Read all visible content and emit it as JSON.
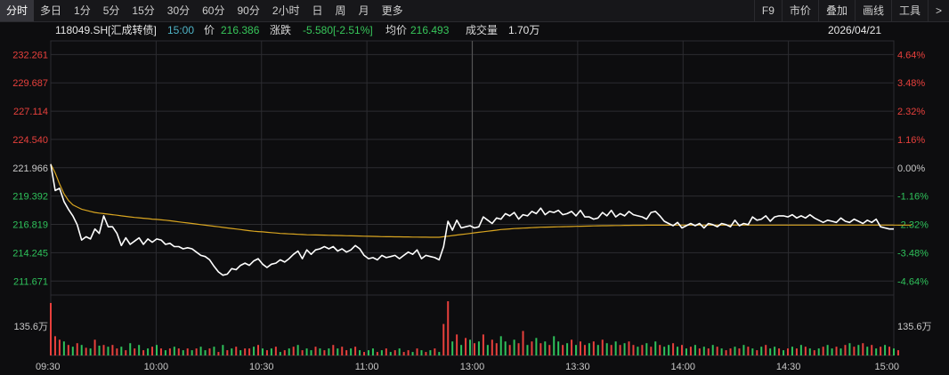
{
  "toolbar": {
    "tabs": [
      "分时",
      "多日",
      "1分",
      "5分",
      "15分",
      "30分",
      "60分",
      "90分",
      "2小时",
      "日",
      "周",
      "月",
      "更多"
    ],
    "right_buttons": [
      "F9",
      "市价",
      "叠加",
      "画线",
      "工具",
      ">"
    ]
  },
  "info": {
    "code": "118049.SH[汇成转债]",
    "time": "15:00",
    "price_label": "价",
    "price": "216.386",
    "change_label": "涨跌",
    "change": "-5.580[-2.51%]",
    "avg_label": "均价",
    "avg": "216.493",
    "volume_label": "成交量",
    "volume": "1.70万",
    "date": "2026/04/21"
  },
  "colors": {
    "up": "#e8403c",
    "down": "#2fc25b",
    "price_line": "#ffffff",
    "avg_line": "#d9a520",
    "grid": "#2c2c30",
    "neutral_text": "#c8c8c8"
  },
  "chart_data": {
    "type": "line",
    "prev_close": 221.966,
    "ylim": [
      210.4,
      233.5
    ],
    "y_ticks_left": [
      "232.261",
      "229.687",
      "227.114",
      "224.540",
      "221.966",
      "219.392",
      "216.819",
      "214.245",
      "211.671"
    ],
    "y_ticks_right": [
      "4.64%",
      "3.48%",
      "2.32%",
      "1.16%",
      "0.00%",
      "-1.16%",
      "-2.32%",
      "-3.48%",
      "-4.64%"
    ],
    "x_ticks": [
      "09:30",
      "10:00",
      "10:30",
      "11:00",
      "13:00",
      "13:30",
      "14:00",
      "14:30",
      "15:00"
    ],
    "volume_tick": "135.6万",
    "series": [
      {
        "values": [
          222.3,
          219.9,
          220.1,
          218.9,
          218.2,
          217.6,
          216.8,
          215.4,
          215.7,
          215.5,
          216.4,
          216.0,
          217.6,
          216.6,
          216.6,
          216.0,
          214.9,
          215.6,
          215.0,
          215.3,
          215.6,
          215.0,
          215.5,
          215.2,
          215.5,
          215.4,
          215.0,
          215.1,
          214.8,
          214.8,
          214.6,
          214.7,
          214.6,
          214.3,
          214.0,
          213.9,
          213.6,
          213.0,
          212.5,
          212.2,
          212.3,
          212.8,
          212.7,
          213.1,
          213.3,
          213.1,
          213.5,
          213.7,
          213.2,
          212.9,
          213.2,
          213.3,
          213.6,
          213.4,
          213.7,
          214.1,
          214.4,
          213.7,
          214.5,
          214.1,
          214.5,
          214.6,
          214.8,
          214.6,
          214.8,
          214.4,
          214.6,
          214.3,
          214.5,
          214.9,
          214.6,
          214.0,
          213.7,
          213.8,
          213.6,
          214.0,
          213.8,
          213.9,
          214.0,
          213.7,
          214.0,
          214.3,
          214.1,
          214.5,
          213.7,
          214.0,
          213.9,
          213.8,
          213.6,
          214.8,
          217.1,
          216.3,
          217.2,
          216.5,
          216.6,
          216.7,
          216.5,
          216.6,
          217.5,
          217.2,
          216.9,
          217.4,
          217.3,
          217.8,
          217.6,
          217.9,
          217.3,
          217.7,
          217.6,
          218.0,
          217.8,
          218.3,
          217.7,
          218.0,
          217.9,
          218.1,
          217.7,
          217.8,
          218.0,
          217.6,
          218.1,
          217.5,
          217.5,
          217.3,
          217.4,
          217.9,
          217.6,
          218.1,
          217.5,
          217.8,
          217.6,
          218.0,
          217.7,
          217.6,
          217.5,
          217.3,
          217.9,
          218.0,
          217.6,
          217.1,
          216.9,
          216.7,
          217.0,
          216.5,
          216.7,
          216.9,
          216.7,
          216.9,
          216.5,
          216.9,
          216.8,
          216.6,
          216.9,
          216.8,
          216.6,
          217.2,
          216.7,
          216.9,
          216.8,
          217.5,
          217.2,
          217.3,
          217.6,
          217.1,
          217.5,
          217.6,
          217.6,
          217.5,
          217.7,
          217.4,
          217.6,
          217.4,
          217.7,
          217.4,
          217.2,
          217.0,
          217.2,
          217.1,
          217.0,
          217.4,
          217.1,
          217.0,
          217.3,
          217.1,
          216.9,
          217.2,
          217.0,
          217.3,
          216.6,
          216.5,
          216.4,
          216.4
        ]
      },
      {
        "values": [
          222.3,
          221.5,
          220.5,
          219.6,
          219.0,
          218.6,
          218.4,
          218.2,
          218.1,
          218.0,
          217.9,
          217.85,
          217.8,
          217.75,
          217.7,
          217.65,
          217.6,
          217.55,
          217.5,
          217.45,
          217.42,
          217.38,
          217.35,
          217.3,
          217.27,
          217.23,
          217.2,
          217.15,
          217.1,
          217.05,
          217.0,
          216.95,
          216.9,
          216.85,
          216.8,
          216.75,
          216.7,
          216.65,
          216.6,
          216.55,
          216.5,
          216.45,
          216.4,
          216.35,
          216.3,
          216.25,
          216.2,
          216.17,
          216.14,
          216.1,
          216.07,
          216.04,
          216.0,
          215.98,
          215.96,
          215.94,
          215.92,
          215.9,
          215.88,
          215.87,
          215.86,
          215.85,
          215.84,
          215.83,
          215.82,
          215.81,
          215.8,
          215.79,
          215.78,
          215.77,
          215.76,
          215.75,
          215.74,
          215.73,
          215.72,
          215.71,
          215.7,
          215.7,
          215.69,
          215.69,
          215.68,
          215.68,
          215.67,
          215.67,
          215.66,
          215.66,
          215.65,
          215.65,
          215.65,
          215.7,
          215.75,
          215.8,
          215.85,
          215.9,
          215.95,
          216.0,
          216.05,
          216.1,
          216.15,
          216.2,
          216.25,
          216.3,
          216.35,
          216.38,
          216.41,
          216.44,
          216.46,
          216.48,
          216.5,
          216.52,
          216.54,
          216.56,
          216.57,
          216.58,
          216.59,
          216.6,
          216.61,
          216.62,
          216.63,
          216.64,
          216.65,
          216.66,
          216.67,
          216.68,
          216.69,
          216.7,
          216.7,
          216.71,
          216.72,
          216.72,
          216.73,
          216.73,
          216.74,
          216.74,
          216.74,
          216.75,
          216.75,
          216.75,
          216.75,
          216.75,
          216.75,
          216.76,
          216.76,
          216.76,
          216.76,
          216.76,
          216.76,
          216.76,
          216.76,
          216.76,
          216.76,
          216.76,
          216.76,
          216.76,
          216.76,
          216.76,
          216.76,
          216.76,
          216.76,
          216.76,
          216.76,
          216.76,
          216.76,
          216.76,
          216.76,
          216.76,
          216.76,
          216.76,
          216.76,
          216.76,
          216.76,
          216.76,
          216.76,
          216.76,
          216.76,
          216.76,
          216.76,
          216.76,
          216.76,
          216.76,
          216.76,
          216.76,
          216.76,
          216.76,
          216.76,
          216.76,
          216.76,
          216.76,
          216.76,
          216.76,
          216.76,
          216.76,
          216.76,
          216.76,
          216.76,
          216.76
        ]
      }
    ],
    "volume_ratio": [
      1.5,
      0.55,
      0.45,
      0.4,
      0.3,
      0.25,
      0.35,
      0.3,
      0.22,
      0.2,
      0.45,
      0.28,
      0.3,
      0.25,
      0.3,
      0.2,
      0.25,
      0.15,
      0.35,
      0.2,
      0.3,
      0.15,
      0.2,
      0.25,
      0.3,
      0.2,
      0.15,
      0.2,
      0.25,
      0.2,
      0.15,
      0.2,
      0.15,
      0.2,
      0.25,
      0.15,
      0.2,
      0.25,
      0.1,
      0.3,
      0.15,
      0.2,
      0.25,
      0.15,
      0.2,
      0.2,
      0.25,
      0.3,
      0.2,
      0.15,
      0.2,
      0.25,
      0.1,
      0.15,
      0.2,
      0.25,
      0.3,
      0.15,
      0.2,
      0.15,
      0.25,
      0.2,
      0.15,
      0.2,
      0.3,
      0.2,
      0.25,
      0.15,
      0.2,
      0.25,
      0.15,
      0.1,
      0.15,
      0.2,
      0.1,
      0.15,
      0.2,
      0.1,
      0.15,
      0.2,
      0.1,
      0.15,
      0.1,
      0.2,
      0.15,
      0.1,
      0.15,
      0.2,
      0.1,
      0.9,
      1.55,
      0.4,
      0.6,
      0.3,
      0.5,
      0.45,
      0.35,
      0.4,
      0.6,
      0.3,
      0.45,
      0.35,
      0.55,
      0.4,
      0.3,
      0.45,
      0.35,
      0.7,
      0.3,
      0.4,
      0.5,
      0.35,
      0.4,
      0.3,
      0.55,
      0.4,
      0.3,
      0.35,
      0.45,
      0.3,
      0.4,
      0.3,
      0.35,
      0.4,
      0.3,
      0.45,
      0.35,
      0.3,
      0.4,
      0.3,
      0.35,
      0.4,
      0.3,
      0.25,
      0.3,
      0.35,
      0.25,
      0.4,
      0.3,
      0.25,
      0.3,
      0.35,
      0.25,
      0.3,
      0.2,
      0.25,
      0.3,
      0.2,
      0.25,
      0.2,
      0.3,
      0.25,
      0.2,
      0.15,
      0.2,
      0.25,
      0.2,
      0.3,
      0.25,
      0.2,
      0.15,
      0.25,
      0.3,
      0.2,
      0.25,
      0.2,
      0.15,
      0.2,
      0.25,
      0.2,
      0.3,
      0.25,
      0.2,
      0.15,
      0.2,
      0.25,
      0.3,
      0.2,
      0.25,
      0.2,
      0.3,
      0.35,
      0.25,
      0.3,
      0.35,
      0.25,
      0.3,
      0.2,
      0.25,
      0.3,
      0.25,
      0.2,
      0.15
    ],
    "volume_dir": [
      1,
      1,
      1,
      0,
      1,
      0,
      1,
      0,
      1,
      0,
      1,
      0,
      1,
      0,
      1,
      1,
      0,
      1,
      0,
      1,
      0,
      1,
      0,
      1,
      0,
      1,
      0,
      1,
      0,
      1,
      0,
      1,
      0,
      1,
      0,
      0,
      1,
      0,
      1,
      0,
      1,
      0,
      1,
      0,
      1,
      1,
      0,
      1,
      0,
      1,
      0,
      1,
      0,
      1,
      0,
      1,
      0,
      1,
      0,
      0,
      1,
      0,
      1,
      0,
      1,
      0,
      1,
      1,
      0,
      1,
      0,
      1,
      0,
      0,
      1,
      0,
      1,
      0,
      1,
      0,
      1,
      1,
      0,
      1,
      0,
      1,
      0,
      1,
      0,
      1,
      1,
      0,
      1,
      0,
      1,
      0,
      1,
      0,
      1,
      0,
      1,
      1,
      0,
      0,
      1,
      0,
      1,
      1,
      0,
      1,
      0,
      1,
      0,
      1,
      0,
      0,
      1,
      0,
      1,
      0,
      1,
      1,
      0,
      1,
      0,
      1,
      0,
      1,
      0,
      1,
      0,
      1,
      1,
      0,
      1,
      0,
      1,
      0,
      1,
      0,
      0,
      1,
      0,
      1,
      0,
      1,
      0,
      1,
      0,
      1,
      0,
      1,
      0,
      1,
      1,
      0,
      1,
      0,
      1,
      0,
      1,
      0,
      1,
      0,
      0,
      1,
      0,
      1,
      0,
      1,
      0,
      1,
      0,
      1,
      0,
      1,
      0,
      0,
      1,
      0,
      1,
      0,
      1,
      0,
      1,
      0,
      1,
      0,
      1,
      0,
      1,
      0,
      1,
      0,
      0
    ]
  }
}
